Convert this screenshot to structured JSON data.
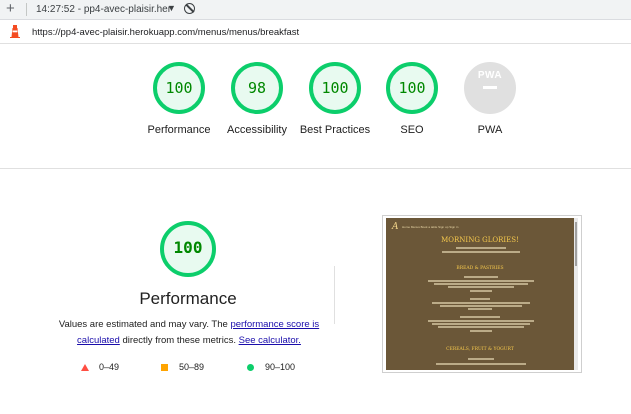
{
  "browser": {
    "tab_title": "14:27:52 - pp4-avec-plaisir.her",
    "url": "https://pp4-avec-plaisir.herokuapp.com/menus/menus/breakfast"
  },
  "scores": [
    {
      "label": "Performance",
      "value": "100",
      "color": "#0cce6b"
    },
    {
      "label": "Accessibility",
      "value": "98",
      "color": "#0cce6b"
    },
    {
      "label": "Best Practices",
      "value": "100",
      "color": "#0cce6b"
    },
    {
      "label": "SEO",
      "value": "100",
      "color": "#0cce6b"
    },
    {
      "label": "PWA",
      "value": "PWA",
      "color": "#e0e0e0"
    }
  ],
  "performance": {
    "score": "100",
    "title": "Performance",
    "desc_prefix": "Values are estimated and may vary. The ",
    "link_score": "performance score is calculated",
    "desc_mid": " directly from these metrics. ",
    "link_calc": "See calculator."
  },
  "legend": {
    "fail": "0–49",
    "average": "50–89",
    "pass": "90–100"
  },
  "thumbnail": {
    "logo": "A",
    "nav": "Home  Menus  Book a table  Sign up  Sign in",
    "heading": "MORNING GLORIES!",
    "section1": "BREAD & PASTRIES",
    "section2": "CEREALS, FRUIT & YOGURT"
  }
}
